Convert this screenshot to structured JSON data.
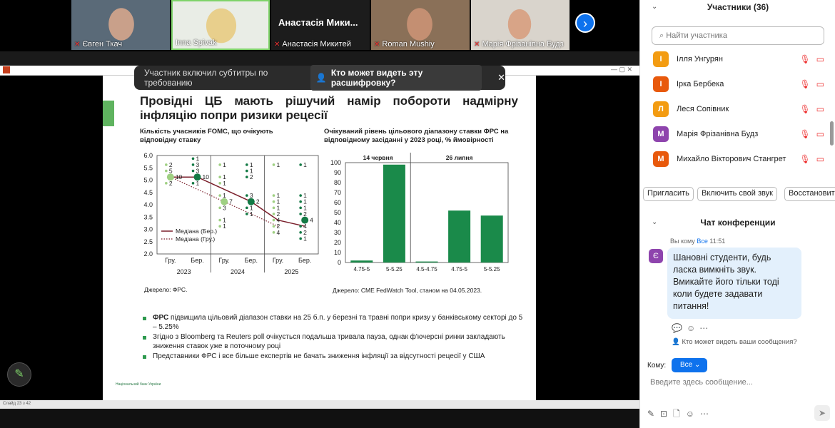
{
  "video_tiles": [
    {
      "name": "Євген Ткач",
      "muted": true
    },
    {
      "name": "Inna Spivak",
      "muted": false
    },
    {
      "name": "Анастасія Микитей",
      "muted": true,
      "big": "Анастасія Мики..."
    },
    {
      "name": "Roman Mushiy",
      "muted": true
    },
    {
      "name": "Марія Фрізанівна Будз",
      "muted": true
    }
  ],
  "subtitle_banner": {
    "text": "Участник включил субтитры по требованию",
    "who": "Кто может видеть эту расшифровку?"
  },
  "slide": {
    "title": "Провідні ЦБ мають рішучий намір побороти надмірну інфляцію попри ризики рецесії",
    "chart1_title": "Кількість учасників FOMC, що очікують відповідну ставку",
    "chart2_title": "Очікуваний рівень цільового діапазону ставки ФРС на відповідному засіданні у 2023 році, % ймовірності",
    "source1": "Джерело: ФРС.",
    "source2": "Джерело: CME FedWatch Tool, станом на 04.05.2023.",
    "bullets": [
      {
        "bold": "ФРС",
        "text": " підвищила цільовий діапазон ставки на 25 б.п. у березні та травні попри кризу у банківському секторі до 5 – 5.25%"
      },
      {
        "bold": "",
        "text": "Згідно з Bloomberg та Reuters poll очікується подальша тривала пауза, однак ф'ючерсні ринки закладають зниження ставок уже в поточному році"
      },
      {
        "bold": "",
        "text": "Представники ФРС і все більше експертів не бачать зниження інфляції за відсутності рецесії у США"
      }
    ],
    "logo": "Національний банк України",
    "status": "Слайд 23 з 42"
  },
  "chart_data": [
    {
      "type": "scatter",
      "title": "Кількість учасників FOMC, що очікують відповідну ставку",
      "categories": [
        "Гру.",
        "Бер.",
        "Гру.",
        "Бер.",
        "Гру.",
        "Бер."
      ],
      "groups": [
        "2023",
        "2024",
        "2025"
      ],
      "ylim": [
        2.0,
        6.0
      ],
      "yticks": [
        "2.0",
        "2.5",
        "3.0",
        "3.5",
        "4.0",
        "4.5",
        "5.0",
        "5.5",
        "6.0"
      ],
      "series": [
        {
          "name": "Медіана (Бер.)",
          "values": [
            5.125,
            5.125,
            4.625,
            4.125,
            3.375,
            3.125
          ],
          "color": "#7a1f2b"
        },
        {
          "name": "Медіана (Гру.)",
          "values": [
            5.125,
            null,
            4.125,
            null,
            3.125,
            null
          ],
          "color": "#7a1f2b"
        }
      ],
      "dots": [
        {
          "c": 0,
          "y": 5.625,
          "n": "2",
          "mk": "l"
        },
        {
          "c": 0,
          "y": 5.375,
          "n": "5",
          "mk": "l"
        },
        {
          "c": 0,
          "y": 5.125,
          "n": "10",
          "mk": "L"
        },
        {
          "c": 0,
          "y": 4.875,
          "n": "2",
          "mk": "l"
        },
        {
          "c": 1,
          "y": 5.875,
          "n": "1",
          "mk": "d"
        },
        {
          "c": 1,
          "y": 5.625,
          "n": "3",
          "mk": "d"
        },
        {
          "c": 1,
          "y": 5.375,
          "n": "3",
          "mk": "d"
        },
        {
          "c": 1,
          "y": 5.125,
          "n": "10",
          "mk": "D"
        },
        {
          "c": 1,
          "y": 4.875,
          "n": "1",
          "mk": "d"
        },
        {
          "c": 2,
          "y": 5.625,
          "n": "1",
          "mk": "l"
        },
        {
          "c": 2,
          "y": 5.125,
          "n": "1",
          "mk": "l"
        },
        {
          "c": 2,
          "y": 4.875,
          "n": "1",
          "mk": "l"
        },
        {
          "c": 2,
          "y": 4.375,
          "n": "1",
          "mk": "l"
        },
        {
          "c": 2,
          "y": 4.125,
          "n": "7",
          "mk": "L"
        },
        {
          "c": 2,
          "y": 3.875,
          "n": "3",
          "mk": "l"
        },
        {
          "c": 2,
          "y": 3.375,
          "n": "1",
          "mk": "l"
        },
        {
          "c": 2,
          "y": 3.125,
          "n": "1",
          "mk": "l"
        },
        {
          "c": 3,
          "y": 5.625,
          "n": "1",
          "mk": "d"
        },
        {
          "c": 3,
          "y": 5.375,
          "n": "1",
          "mk": "d"
        },
        {
          "c": 3,
          "y": 5.125,
          "n": "2",
          "mk": "d"
        },
        {
          "c": 3,
          "y": 4.375,
          "n": "3",
          "mk": "d"
        },
        {
          "c": 3,
          "y": 4.125,
          "n": "2",
          "mk": "D"
        },
        {
          "c": 3,
          "y": 3.875,
          "n": "1",
          "mk": "d"
        },
        {
          "c": 3,
          "y": 3.625,
          "n": "1",
          "mk": "d"
        },
        {
          "c": 4,
          "y": 5.625,
          "n": "1",
          "mk": "l"
        },
        {
          "c": 4,
          "y": 4.375,
          "n": "1",
          "mk": "l"
        },
        {
          "c": 4,
          "y": 4.125,
          "n": "1",
          "mk": "l"
        },
        {
          "c": 4,
          "y": 3.875,
          "n": "1",
          "mk": "l"
        },
        {
          "c": 4,
          "y": 3.625,
          "n": "2",
          "mk": "l"
        },
        {
          "c": 4,
          "y": 3.375,
          "n": "4",
          "mk": "l"
        },
        {
          "c": 4,
          "y": 3.125,
          "n": "2",
          "mk": "l"
        },
        {
          "c": 4,
          "y": 2.875,
          "n": "4",
          "mk": "l"
        },
        {
          "c": 5,
          "y": 5.625,
          "n": "1",
          "mk": "d"
        },
        {
          "c": 5,
          "y": 4.375,
          "n": "1",
          "mk": "d"
        },
        {
          "c": 5,
          "y": 4.125,
          "n": "1",
          "mk": "d"
        },
        {
          "c": 5,
          "y": 3.875,
          "n": "1",
          "mk": "d"
        },
        {
          "c": 5,
          "y": 3.625,
          "n": "2",
          "mk": "d"
        },
        {
          "c": 5,
          "y": 3.375,
          "n": "4",
          "mk": "D"
        },
        {
          "c": 5,
          "y": 3.125,
          "n": "4",
          "mk": "d"
        },
        {
          "c": 5,
          "y": 2.875,
          "n": "2",
          "mk": "d"
        },
        {
          "c": 5,
          "y": 2.625,
          "n": "1",
          "mk": "d"
        }
      ]
    },
    {
      "type": "bar",
      "title": "Очікуваний рівень цільового діапазону ставки ФРС на відповідному засіданні у 2023 році, % ймовірності",
      "groups": [
        "14 червня",
        "26 липня"
      ],
      "categories": [
        "4.75-5",
        "5-5.25",
        "4.5-4.75",
        "4.75-5",
        "5-5.25"
      ],
      "values": [
        2,
        98,
        1,
        52,
        47
      ],
      "ylim": [
        0,
        100
      ],
      "yticks": [
        "0",
        "10",
        "20",
        "30",
        "40",
        "50",
        "60",
        "70",
        "80",
        "90",
        "100"
      ],
      "color": "#1a8a4a"
    }
  ],
  "panel": {
    "participants_title": "Участники (36)",
    "search_placeholder": "Найти участника",
    "participants": [
      {
        "initial": "І",
        "name": "Ілля Унгурян",
        "color": "#f39c12"
      },
      {
        "initial": "І",
        "name": "Ірка Бербека",
        "color": "#e8590c"
      },
      {
        "initial": "Л",
        "name": "Леся Сопівник",
        "color": "#f39c12"
      },
      {
        "initial": "М",
        "name": "Марія Фрізанівна Будз",
        "color": "#8e44ad"
      },
      {
        "initial": "М",
        "name": "Михайло Вікторович Стангрет",
        "color": "#e8590c"
      }
    ],
    "buttons": [
      "Пригласить",
      "Включить свой звук",
      "Восстановить"
    ],
    "chat_title": "Чат конференции",
    "chat_from": "Вы кому",
    "chat_to": "Все",
    "chat_time": "11:51",
    "chat_avatar": "Є",
    "chat_message": "Шановні студенти, будь ласка вимкніть звук. Вмикайте його тільки тоді коли будете задавати питання!",
    "who_can_see": "Кто может видеть ваши сообщения?",
    "to_label": "Кому:",
    "to_value": "Все",
    "input_placeholder": "Введите здесь сообщение..."
  }
}
